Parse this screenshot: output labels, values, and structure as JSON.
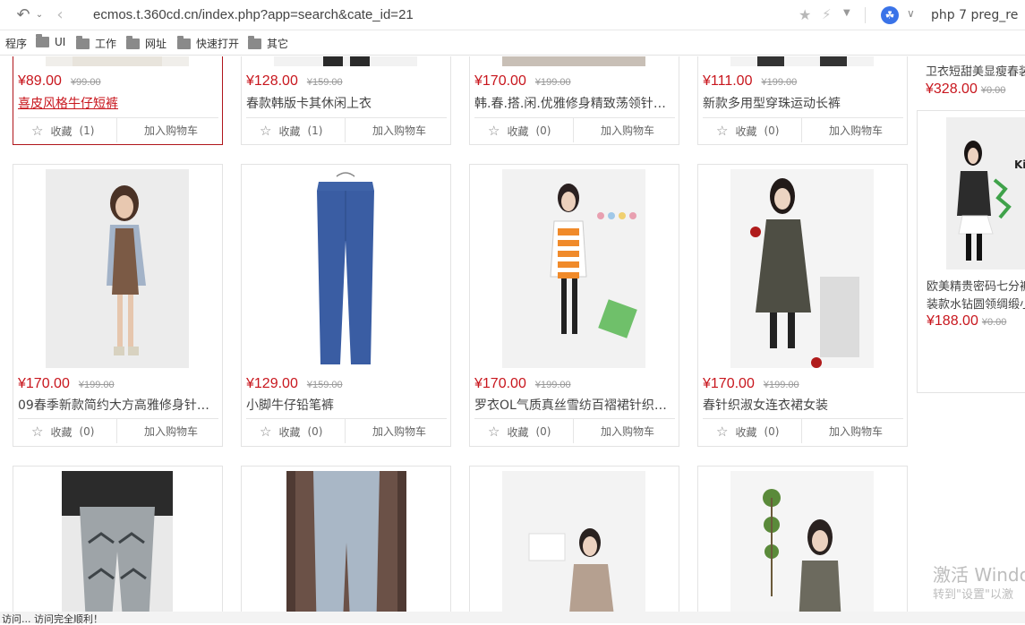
{
  "browser": {
    "url": "ecmos.t.360cd.cn/index.php?app=search&cate_id=21",
    "search_text": "php 7 preg_re"
  },
  "bookmarks": [
    {
      "label": "程序",
      "folder": false
    },
    {
      "label": "UI",
      "folder": true
    },
    {
      "label": "工作",
      "folder": true
    },
    {
      "label": "网址",
      "folder": true
    },
    {
      "label": "快速打开",
      "folder": true
    },
    {
      "label": "其它",
      "folder": true
    }
  ],
  "products": {
    "row1": [
      {
        "price": "¥89.00",
        "old": "¥99.00",
        "title": "喜皮风格牛仔短裤",
        "fav": "收藏",
        "count": "(1)",
        "cart": "加入购物车"
      },
      {
        "price": "¥128.00",
        "old": "¥159.00",
        "title": "春款韩版卡其休闲上衣",
        "fav": "收藏",
        "count": "(1)",
        "cart": "加入购物车"
      },
      {
        "price": "¥170.00",
        "old": "¥199.00",
        "title": "韩.春.搭.闲.优雅修身精致荡领针织...",
        "fav": "收藏",
        "count": "(0)",
        "cart": "加入购物车"
      },
      {
        "price": "¥111.00",
        "old": "¥199.00",
        "title": "新款多用型穿珠运动长裤",
        "fav": "收藏",
        "count": "(0)",
        "cart": "加入购物车"
      }
    ],
    "row2": [
      {
        "price": "¥170.00",
        "old": "¥199.00",
        "title": "09春季新款简约大方高雅修身针织...",
        "fav": "收藏",
        "count": "(0)",
        "cart": "加入购物车"
      },
      {
        "price": "¥129.00",
        "old": "¥159.00",
        "title": "小脚牛仔铅笔裤",
        "fav": "收藏",
        "count": "(0)",
        "cart": "加入购物车"
      },
      {
        "price": "¥170.00",
        "old": "¥199.00",
        "title": "罗衣OL气质真丝雪纺百褶裙针织背...",
        "fav": "收藏",
        "count": "(0)",
        "cart": "加入购物车"
      },
      {
        "price": "¥170.00",
        "old": "¥199.00",
        "title": "春针织淑女连衣裙女装",
        "fav": "收藏",
        "count": "(0)",
        "cart": "加入购物车"
      }
    ]
  },
  "sidebar": {
    "top_text": "卫衣短甜美显瘦春装",
    "top_price": "¥328.00",
    "top_old": "¥0.00",
    "thumb_text": "Kid",
    "title_line1": "欧美精贵密码七分裤",
    "title_line2": "装款水钻圆领绸缎小",
    "price": "¥188.00",
    "old": "¥0.00"
  },
  "watermark": {
    "line1": "激活 Windo",
    "line2": "转到\"设置\"以激"
  },
  "status": "访问... 访问完全顺利！"
}
